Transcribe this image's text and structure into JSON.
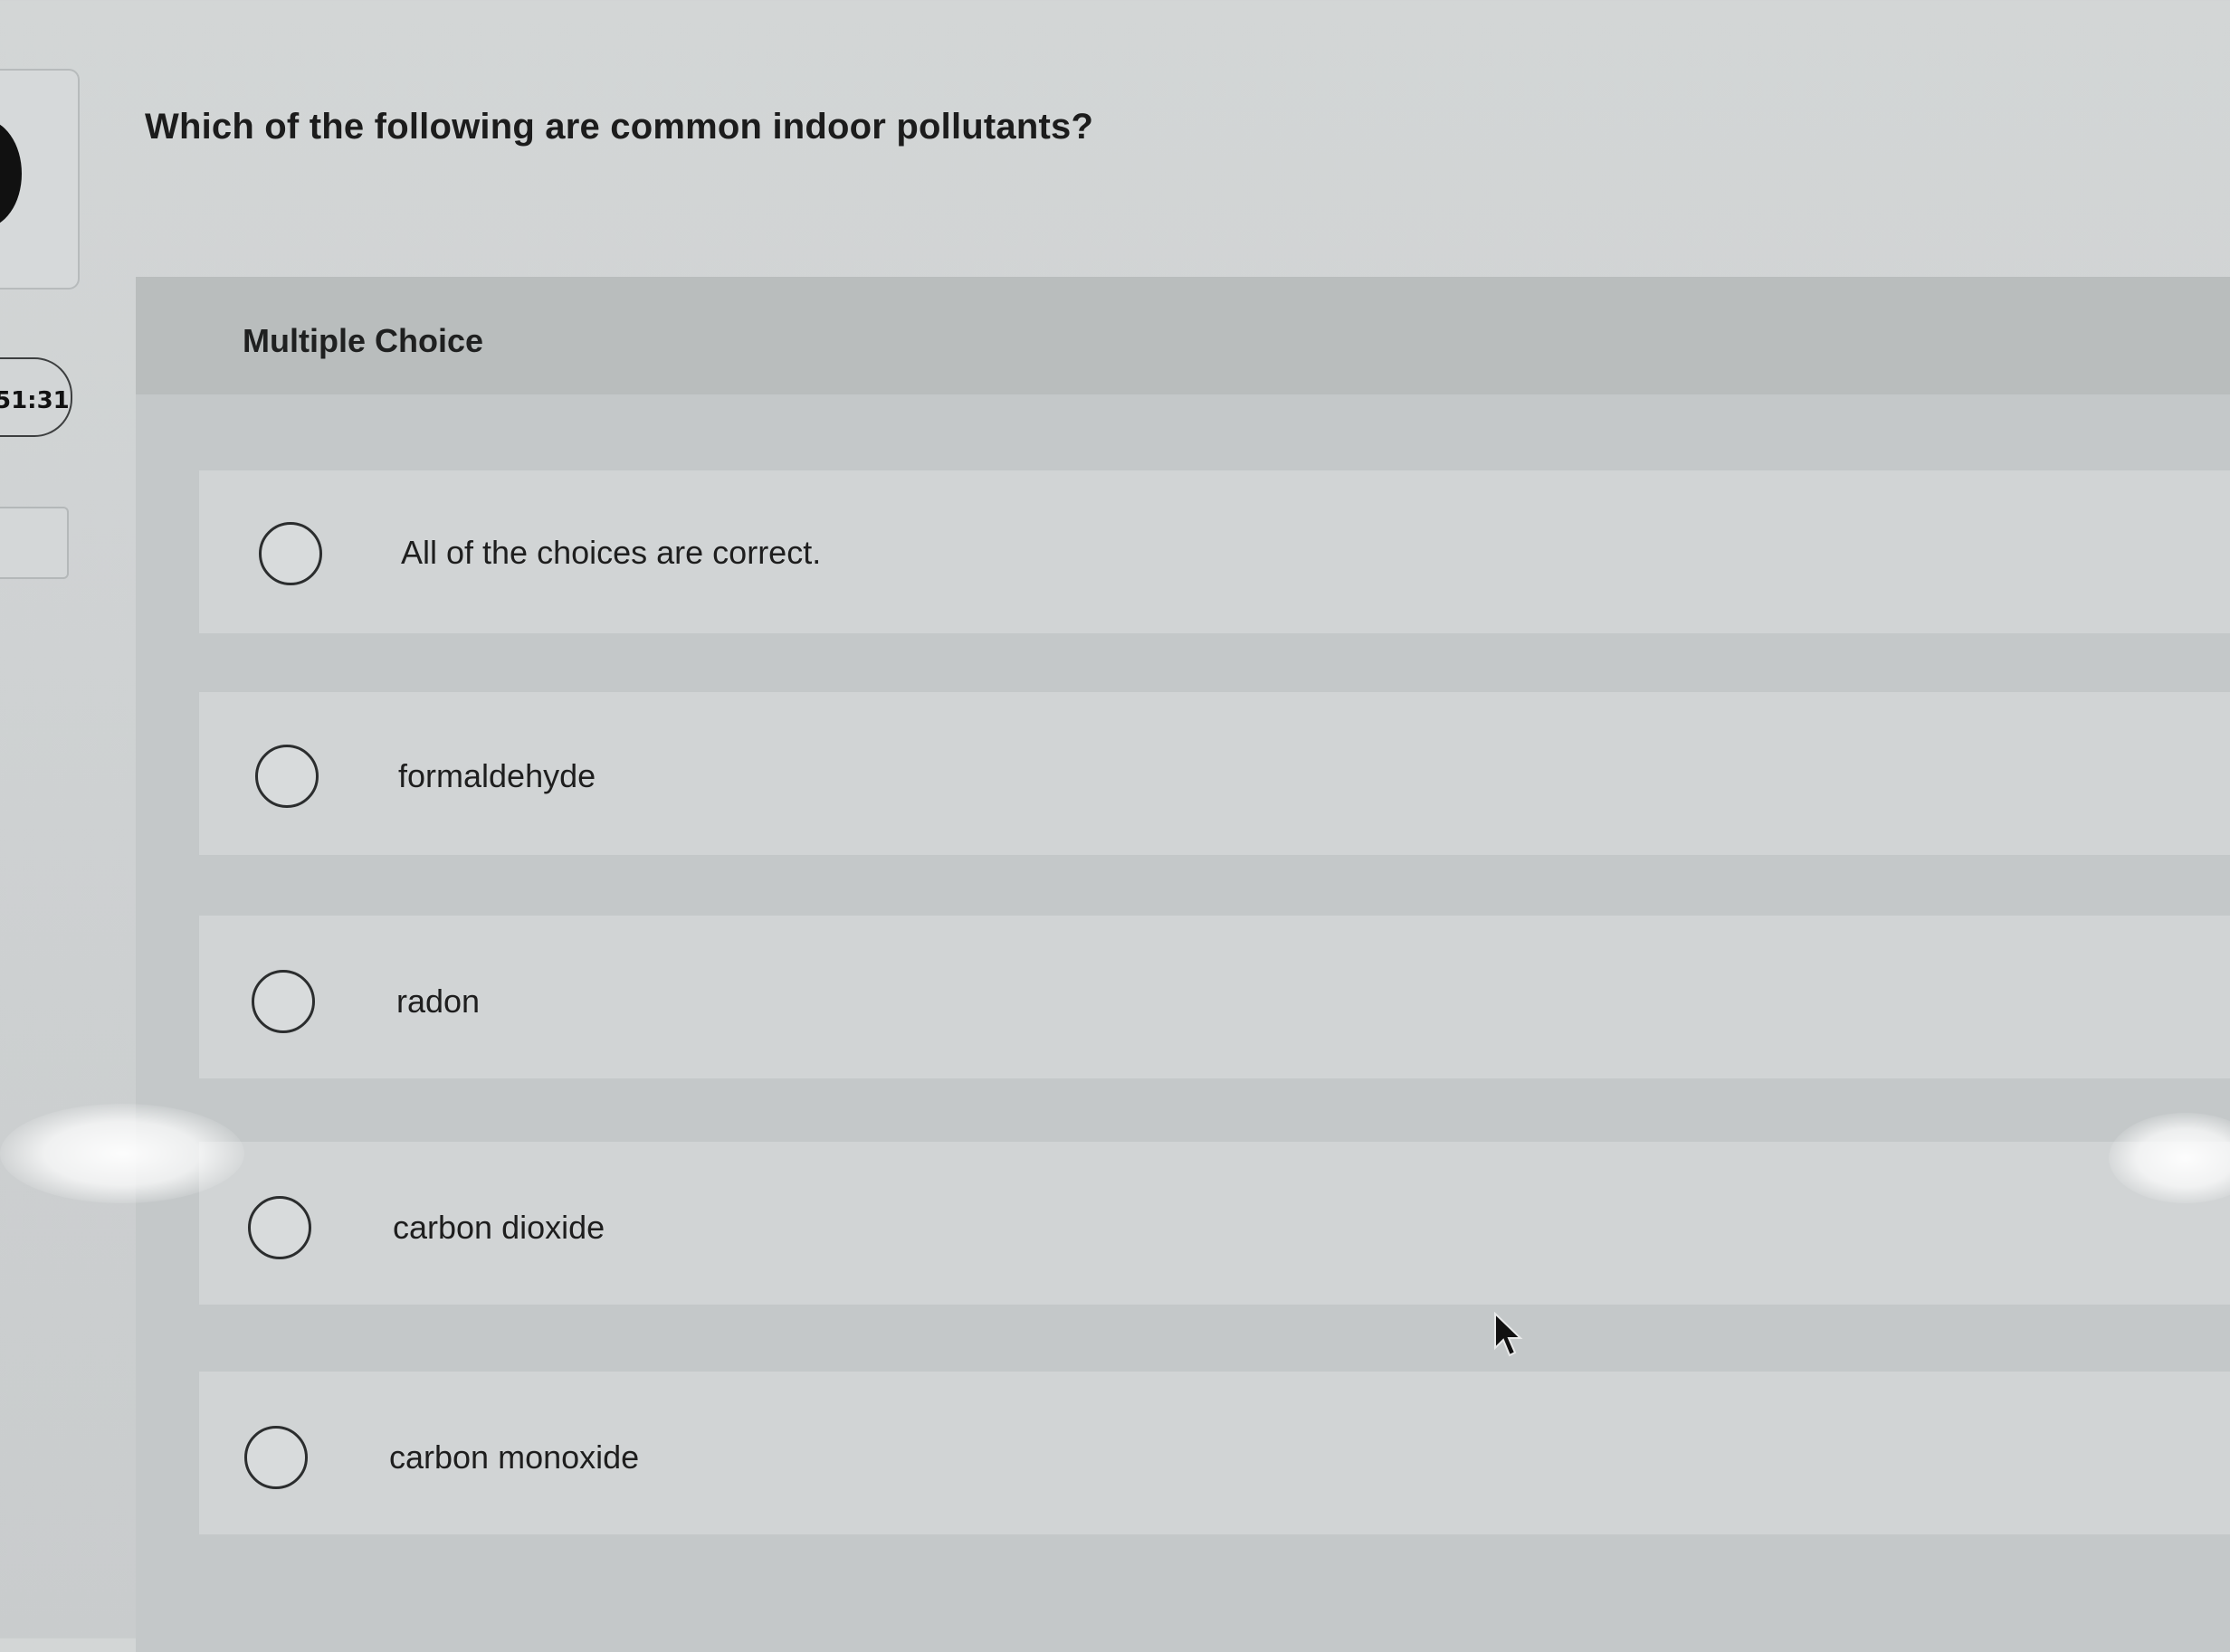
{
  "sidebar": {
    "timer": "51:31"
  },
  "question": {
    "text": "Which of the following are common indoor pollutants?"
  },
  "answer_panel": {
    "type_label": "Multiple Choice",
    "options": [
      {
        "label": "All of the choices are correct.",
        "selected": false
      },
      {
        "label": "formaldehyde",
        "selected": false
      },
      {
        "label": "radon",
        "selected": false
      },
      {
        "label": "carbon dioxide",
        "selected": false
      },
      {
        "label": "carbon monoxide",
        "selected": false
      }
    ]
  },
  "icons": {
    "question-number-badge": "badge-icon",
    "cursor": "mouse-pointer-icon"
  },
  "colors": {
    "background": "#cfd2d3",
    "panel": "#c4c8c9",
    "text": "#1c1c1c"
  }
}
